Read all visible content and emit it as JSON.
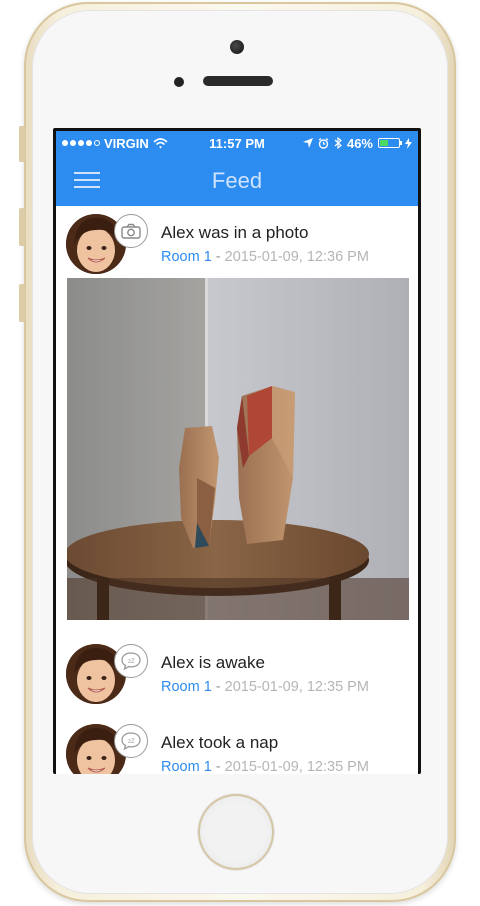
{
  "status_bar": {
    "carrier": "VIRGIN",
    "time": "11:57 PM",
    "battery_percent": "46%",
    "battery_level": 0.46,
    "signal_bars_filled": 4,
    "signal_bars_total": 5
  },
  "nav": {
    "title": "Feed"
  },
  "feed": [
    {
      "title": "Alex was in a photo",
      "room": "Room 1",
      "separator": "-",
      "timestamp": "2015-01-09, 12:36 PM",
      "badge_icon": "camera-icon"
    },
    {
      "title": "Alex is awake",
      "room": "Room 1",
      "separator": "-",
      "timestamp": "2015-01-09, 12:35 PM",
      "badge_icon": "sleep-bubble-icon"
    },
    {
      "title": "Alex took a nap",
      "room": "Room 1",
      "separator": "-",
      "timestamp": "2015-01-09, 12:35 PM",
      "badge_icon": "sleep-bubble-icon"
    }
  ],
  "colors": {
    "accent": "#2d8cf0",
    "meta_text": "#b5b5b5",
    "battery_fill": "#4cd964"
  }
}
